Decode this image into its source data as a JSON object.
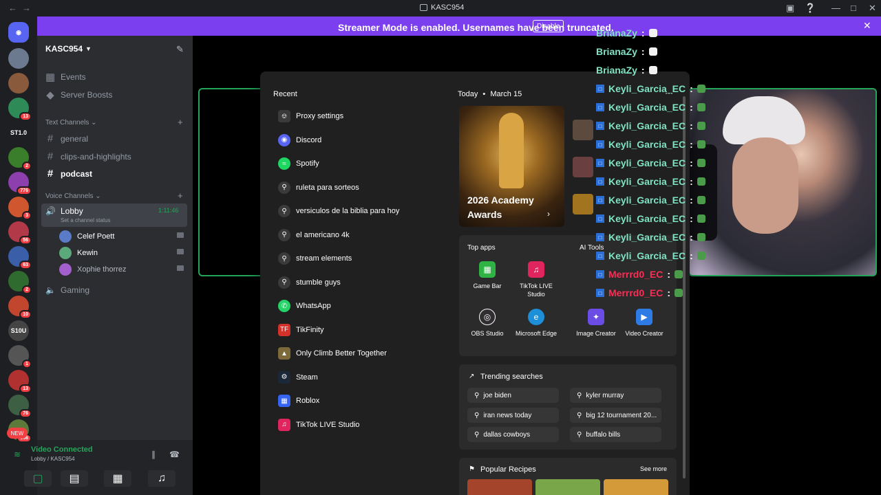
{
  "titlebar": {
    "title": "KASC954"
  },
  "banner": {
    "message": "Streamer Mode is enabled. Usernames have been truncated.",
    "button": "Disable"
  },
  "rail": {
    "items": [
      {
        "label": "",
        "badge": ""
      },
      {
        "label": "",
        "badge": ""
      },
      {
        "label": "",
        "badge": "13"
      },
      {
        "label": "ST1.0",
        "badge": ""
      },
      {
        "label": "",
        "badge": "2"
      },
      {
        "label": "",
        "badge": "776"
      },
      {
        "label": "",
        "badge": "3"
      },
      {
        "label": "",
        "badge": "56"
      },
      {
        "label": "",
        "badge": "63"
      },
      {
        "label": "",
        "badge": "2"
      },
      {
        "label": "",
        "badge": "10"
      },
      {
        "label": "S10U",
        "badge": ""
      },
      {
        "label": "",
        "badge": "1"
      },
      {
        "label": "",
        "badge": "13"
      },
      {
        "label": "",
        "badge": "76"
      },
      {
        "label": "",
        "badge": "666"
      },
      {
        "label": "NEW",
        "badge": ""
      }
    ]
  },
  "server": {
    "name": "KASC954"
  },
  "channels": {
    "events": "Events",
    "boosts": "Server Boosts",
    "text_category": "Text Channels",
    "text": [
      "general",
      "clips-and-highlights",
      "podcast"
    ],
    "voice_category": "Voice Channels",
    "lobby": "Lobby",
    "lobby_time": "1:11:46",
    "lobby_status": "Set a channel status",
    "users": [
      "Celef Poett",
      "Kewin",
      "Xophie thorrez"
    ],
    "gaming": "Gaming"
  },
  "voice": {
    "status": "Video Connected",
    "location": "Lobby / KASC954"
  },
  "start": {
    "recent_heading": "Recent",
    "recent": [
      {
        "label": "Proxy settings",
        "icon": "settings-icon",
        "color": "#3a3a3a"
      },
      {
        "label": "Discord",
        "icon": "discord-icon",
        "color": "#5865f2"
      },
      {
        "label": "Spotify",
        "icon": "spotify-icon",
        "color": "#1ed760"
      },
      {
        "label": "ruleta para sorteos",
        "icon": "search-icon",
        "color": "#3a3a3a"
      },
      {
        "label": "versiculos de la biblia para hoy",
        "icon": "search-icon",
        "color": "#3a3a3a"
      },
      {
        "label": "el americano 4k",
        "icon": "search-icon",
        "color": "#3a3a3a"
      },
      {
        "label": "stream elements",
        "icon": "search-icon",
        "color": "#3a3a3a"
      },
      {
        "label": "stumble guys",
        "icon": "search-icon",
        "color": "#3a3a3a"
      },
      {
        "label": "WhatsApp",
        "icon": "whatsapp-icon",
        "color": "#25d366"
      },
      {
        "label": "TikFinity",
        "icon": "tikfinity-icon",
        "color": "#d3322a"
      },
      {
        "label": "Only Climb Better Together",
        "icon": "game-icon",
        "color": "#7d6a3a"
      },
      {
        "label": "Steam",
        "icon": "steam-icon",
        "color": "#1b2838"
      },
      {
        "label": "Roblox",
        "icon": "roblox-icon",
        "color": "#3565f0"
      },
      {
        "label": "TikTok LIVE Studio",
        "icon": "tiktok-icon",
        "color": "#e0245e"
      }
    ],
    "today": "Today",
    "date": "March 15",
    "hero": "2026 Academy Awards",
    "top_apps_heading": "Top apps",
    "ai_tools_heading": "AI Tools",
    "apps": [
      {
        "label": "Game Bar",
        "color": "#2fb344"
      },
      {
        "label": "TikTok LIVE Studio",
        "color": "#e0245e"
      },
      {
        "label": "OBS Studio",
        "color": "#302e31"
      },
      {
        "label": "Microsoft Edge",
        "color": "#1d8fd8"
      },
      {
        "label": "Image Creator",
        "color": "#6b4de6"
      },
      {
        "label": "Video Creator",
        "color": "#2e7be6"
      }
    ],
    "trending_heading": "Trending searches",
    "trending": [
      "joe biden",
      "kyler murray",
      "iran news today",
      "big 12 tournament 20...",
      "dallas cowboys",
      "buffalo bills"
    ],
    "recipes_heading": "Popular Recipes",
    "see_more": "See more"
  },
  "chat": {
    "messages": [
      {
        "user": "BrianaZy",
        "color": "#7fe3c4",
        "twitch": false
      },
      {
        "user": "BrianaZy",
        "color": "#7fe3c4",
        "twitch": false
      },
      {
        "user": "BrianaZy",
        "color": "#7fe3c4",
        "twitch": false
      },
      {
        "user": "Keyli_Garcia_EC",
        "color": "#7fe3c4",
        "twitch": true
      },
      {
        "user": "Keyli_Garcia_EC",
        "color": "#7fe3c4",
        "twitch": true
      },
      {
        "user": "Keyli_Garcia_EC",
        "color": "#7fe3c4",
        "twitch": true
      },
      {
        "user": "Keyli_Garcia_EC",
        "color": "#7fe3c4",
        "twitch": true
      },
      {
        "user": "Keyli_Garcia_EC",
        "color": "#7fe3c4",
        "twitch": true
      },
      {
        "user": "Keyli_Garcia_EC",
        "color": "#7fe3c4",
        "twitch": true
      },
      {
        "user": "Keyli_Garcia_EC",
        "color": "#7fe3c4",
        "twitch": true
      },
      {
        "user": "Keyli_Garcia_EC",
        "color": "#7fe3c4",
        "twitch": true
      },
      {
        "user": "Keyli_Garcia_EC",
        "color": "#7fe3c4",
        "twitch": true
      },
      {
        "user": "Keyli_Garcia_EC",
        "color": "#7fe3c4",
        "twitch": true
      },
      {
        "user": "Merrrd0_EC",
        "color": "#ff2d55",
        "twitch": true
      },
      {
        "user": "Merrrd0_EC",
        "color": "#ff2d55",
        "twitch": true
      }
    ]
  }
}
